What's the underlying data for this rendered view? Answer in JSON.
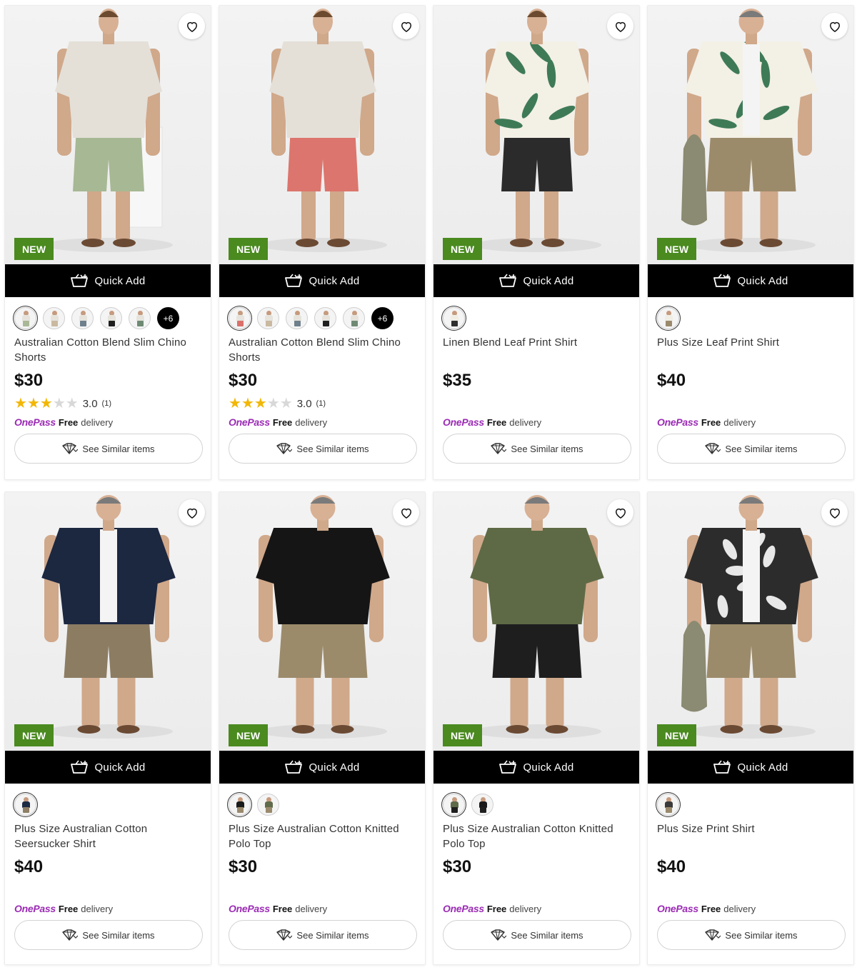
{
  "products": [
    {
      "name": "Australian Cotton Blend Slim Chino Shorts",
      "price": "$30",
      "badge": "NEW",
      "quick_add": "Quick Add",
      "rating": "3.0",
      "rating_stars": 3,
      "rating_count": "(1)",
      "swatches": [
        {
          "top": "#e6e3dc",
          "bottom": "#a9b896"
        },
        {
          "top": "#e6e3dc",
          "bottom": "#c9b9a0"
        },
        {
          "top": "#e6e3dc",
          "bottom": "#6f7f8c"
        },
        {
          "top": "#e6e3dc",
          "bottom": "#1f1f1f"
        },
        {
          "top": "#e6e3dc",
          "bottom": "#6f8a74"
        }
      ],
      "more_colors": "+6",
      "onepass": "OnePass",
      "delivery_free": "Free",
      "delivery_text": "delivery",
      "similar": "See Similar items",
      "photo": {
        "shirt": "#e4e0d8",
        "shorts": "#a7b894",
        "pattern": "plain",
        "prop": "pedestal"
      }
    },
    {
      "name": "Australian Cotton Blend Slim Chino Shorts",
      "price": "$30",
      "badge": "NEW",
      "quick_add": "Quick Add",
      "rating": "3.0",
      "rating_stars": 3,
      "rating_count": "(1)",
      "swatches": [
        {
          "top": "#e6e3dc",
          "bottom": "#d9706a"
        },
        {
          "top": "#e6e3dc",
          "bottom": "#c9b9a0"
        },
        {
          "top": "#e6e3dc",
          "bottom": "#6f7f8c"
        },
        {
          "top": "#e6e3dc",
          "bottom": "#1f1f1f"
        },
        {
          "top": "#e6e3dc",
          "bottom": "#6f8a74"
        }
      ],
      "more_colors": "+6",
      "onepass": "OnePass",
      "delivery_free": "Free",
      "delivery_text": "delivery",
      "similar": "See Similar items",
      "photo": {
        "shirt": "#e4e0d8",
        "shorts": "#dc756d",
        "pattern": "plain",
        "prop": "none"
      }
    },
    {
      "name": "Linen Blend Leaf Print Shirt",
      "price": "$35",
      "badge": "NEW",
      "quick_add": "Quick Add",
      "swatches": [
        {
          "top": "#f0ede4",
          "bottom": "#2f2f2f"
        }
      ],
      "onepass": "OnePass",
      "delivery_free": "Free",
      "delivery_text": "delivery",
      "similar": "See Similar items",
      "photo": {
        "shirt": "#f3f0e6",
        "shorts": "#2b2b2b",
        "pattern": "leaf",
        "prop": "none"
      }
    },
    {
      "name": "Plus Size Leaf Print Shirt",
      "price": "$40",
      "badge": "NEW",
      "quick_add": "Quick Add",
      "swatches": [
        {
          "top": "#f0ede4",
          "bottom": "#9a8a6c"
        }
      ],
      "onepass": "OnePass",
      "delivery_free": "Free",
      "delivery_text": "delivery",
      "similar": "See Similar items",
      "photo": {
        "shirt": "#f3f0e6",
        "shorts": "#9c8b6b",
        "pattern": "leaf",
        "prop": "bag"
      }
    },
    {
      "name": "Plus Size Australian Cotton Seersucker Shirt",
      "price": "$40",
      "badge": "NEW",
      "quick_add": "Quick Add",
      "swatches": [
        {
          "top": "#1d2a44",
          "bottom": "#8f7f66"
        }
      ],
      "onepass": "OnePass",
      "delivery_free": "Free",
      "delivery_text": "delivery",
      "similar": "See Similar items",
      "photo": {
        "shirt": "#1c2740",
        "shorts": "#8c7c62",
        "pattern": "plain",
        "prop": "none"
      }
    },
    {
      "name": "Plus Size Australian Cotton Knitted Polo Top",
      "price": "$30",
      "badge": "NEW",
      "quick_add": "Quick Add",
      "swatches": [
        {
          "top": "#1a1a1a",
          "bottom": "#9a8a6c"
        },
        {
          "top": "#5f6b4a",
          "bottom": "#9a8a6c"
        }
      ],
      "onepass": "OnePass",
      "delivery_free": "Free",
      "delivery_text": "delivery",
      "similar": "See Similar items",
      "photo": {
        "shirt": "#151515",
        "shorts": "#9c8b6b",
        "pattern": "plain",
        "prop": "none"
      }
    },
    {
      "name": "Plus Size Australian Cotton Knitted Polo Top",
      "price": "$30",
      "badge": "NEW",
      "quick_add": "Quick Add",
      "swatches": [
        {
          "top": "#5f6b4a",
          "bottom": "#1f1f1f"
        },
        {
          "top": "#1a1a1a",
          "bottom": "#1f1f1f"
        }
      ],
      "onepass": "OnePass",
      "delivery_free": "Free",
      "delivery_text": "delivery",
      "similar": "See Similar items",
      "photo": {
        "shirt": "#5e6a45",
        "shorts": "#1e1e1e",
        "pattern": "plain",
        "prop": "none"
      }
    },
    {
      "name": "Plus Size Print Shirt",
      "price": "$40",
      "badge": "NEW",
      "quick_add": "Quick Add",
      "swatches": [
        {
          "top": "#3a3a3a",
          "bottom": "#9a8a6c"
        }
      ],
      "onepass": "OnePass",
      "delivery_free": "Free",
      "delivery_text": "delivery",
      "similar": "See Similar items",
      "photo": {
        "shirt": "#2c2c2c",
        "shorts": "#9c8b6b",
        "pattern": "tropical",
        "prop": "bag"
      }
    }
  ]
}
